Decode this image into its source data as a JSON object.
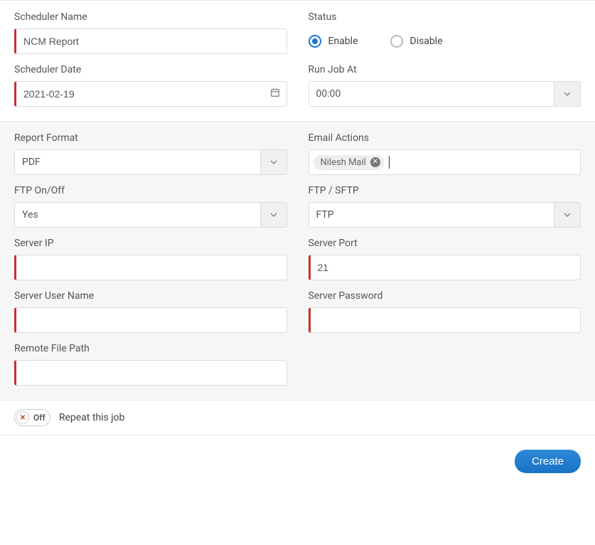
{
  "scheduler": {
    "name_label": "Scheduler Name",
    "name_value": "NCM Report",
    "date_label": "Scheduler Date",
    "date_value": "2021-02-19",
    "status_label": "Status",
    "status_enable": "Enable",
    "status_disable": "Disable",
    "runjob_label": "Run Job At",
    "runjob_value": "00:00"
  },
  "report": {
    "format_label": "Report Format",
    "format_value": "PDF",
    "email_label": "Email Actions",
    "email_tag": "Nilesh Mail",
    "ftp_on_label": "FTP On/Off",
    "ftp_on_value": "Yes",
    "protocol_label": "FTP / SFTP",
    "protocol_value": "FTP",
    "server_ip_label": "Server IP",
    "server_ip_value": "",
    "server_port_label": "Server Port",
    "server_port_value": "21",
    "server_user_label": "Server User Name",
    "server_user_value": "",
    "server_pass_label": "Server Password",
    "server_pass_value": "",
    "remote_path_label": "Remote File Path",
    "remote_path_value": ""
  },
  "repeat": {
    "toggle_text": "Off",
    "label": "Repeat this job"
  },
  "buttons": {
    "create": "Create"
  }
}
